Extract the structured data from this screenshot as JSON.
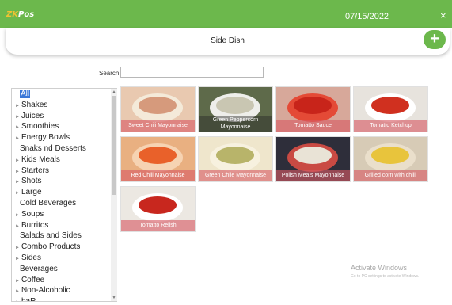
{
  "app": {
    "logo": "ZK Pos",
    "logo_mark": "ZK",
    "logo_rest": "Pos",
    "date": "07/15/2022",
    "close": "×"
  },
  "header": {
    "title": "Side Dish",
    "add_label": "+"
  },
  "search": {
    "label": "Search",
    "value": "",
    "placeholder": ""
  },
  "categories": [
    {
      "label": "All",
      "selected": true,
      "expandable": false
    },
    {
      "label": "Shakes",
      "expandable": true
    },
    {
      "label": "Juices",
      "expandable": true
    },
    {
      "label": "Smoothies",
      "expandable": true
    },
    {
      "label": "Energy Bowls",
      "expandable": true
    },
    {
      "label": "Snaks nd Desserts",
      "expandable": false
    },
    {
      "label": "Kids Meals",
      "expandable": true
    },
    {
      "label": "Starters",
      "expandable": true
    },
    {
      "label": "Shots",
      "expandable": true
    },
    {
      "label": "Large",
      "expandable": true
    },
    {
      "label": "Cold Beverages",
      "expandable": false
    },
    {
      "label": "Soups",
      "expandable": true
    },
    {
      "label": "Burritos",
      "expandable": true
    },
    {
      "label": "Salads and Sides",
      "expandable": false
    },
    {
      "label": "Combo Products",
      "expandable": true
    },
    {
      "label": "Sides",
      "expandable": true
    },
    {
      "label": "Beverages",
      "expandable": false
    },
    {
      "label": "Coffee",
      "expandable": true
    },
    {
      "label": "Non-Alcoholic",
      "expandable": true
    },
    {
      "label": "baR",
      "expandable": true
    }
  ],
  "products": [
    {
      "label": "Sweet Chili Mayonnaise",
      "bg": "#e9c9b0",
      "food": "#d69a7c",
      "bowl": "#f4ead9"
    },
    {
      "label": "Green Peppercorn Mayonnaise",
      "bg": "#5e6a4a",
      "food": "#c9c6b2",
      "bowl": "#eeeeea",
      "two_line": true
    },
    {
      "label": "Tomatto Sauce",
      "bg": "#d7a89a",
      "food": "#c8241a",
      "bowl": "#e44a36"
    },
    {
      "label": "Tomatto Ketchup",
      "bg": "#e7e3dd",
      "food": "#d0301f",
      "bowl": "#ffffff"
    },
    {
      "label": "Red Chili Mayonnaise",
      "bg": "#e9b081",
      "food": "#e9612a",
      "bowl": "#f6d3b2"
    },
    {
      "label": "Green Chile Mayonnaise",
      "bg": "#efe6cc",
      "food": "#b8b46a",
      "bowl": "#f7f1df"
    },
    {
      "label": "Polish Meals Mayonnaise",
      "bg": "#2e2e3a",
      "food": "#e9e3d6",
      "bowl": "#c94a43"
    },
    {
      "label": "Grilled corn with chilli",
      "bg": "#d7cbb6",
      "food": "#e8c43c",
      "bowl": "#eadfcb"
    },
    {
      "label": "Tomatto Relish",
      "bg": "#ece8e2",
      "food": "#c8271e",
      "bowl": "#ffffff"
    }
  ],
  "watermark": {
    "title": "Activate Windows",
    "subtitle": "Go to PC settings to activate Windows."
  },
  "colors": {
    "brand_green": "#6cb84c",
    "selected_blue": "#3b78d8",
    "tile_label": "#d65a64"
  }
}
